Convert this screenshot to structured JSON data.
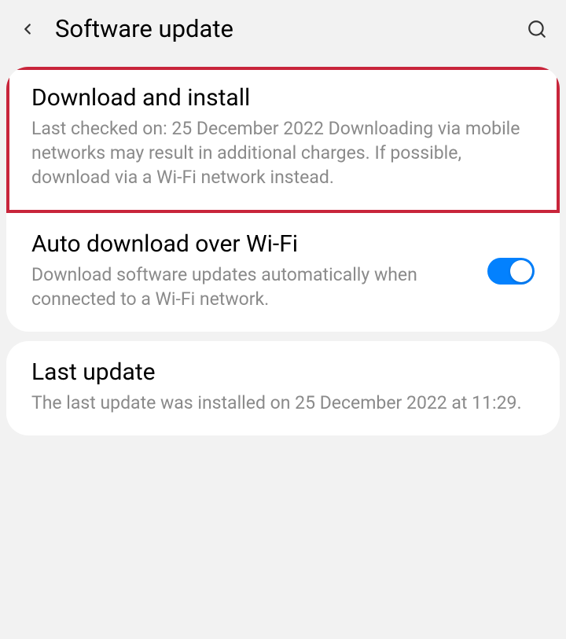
{
  "header": {
    "title": "Software update"
  },
  "items": {
    "download_install": {
      "title": "Download and install",
      "subtitle": "Last checked on: 25 December 2022\nDownloading via mobile networks may result in additional charges. If possible, download via a Wi-Fi network instead."
    },
    "auto_download": {
      "title": "Auto download over Wi-Fi",
      "subtitle": "Download software updates automatically when connected to a Wi-Fi network.",
      "toggle": true
    },
    "last_update": {
      "title": "Last update",
      "subtitle": "The last update was installed on 25 December 2022 at 11:29."
    }
  }
}
